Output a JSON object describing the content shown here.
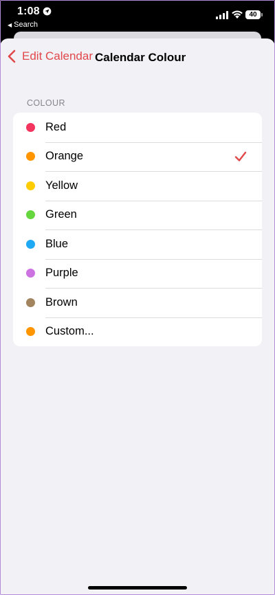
{
  "status_bar": {
    "time": "1:08",
    "back_app": "Search",
    "battery": "40",
    "icons": [
      "location-icon",
      "signal-icon",
      "wifi-icon",
      "battery-icon"
    ]
  },
  "nav": {
    "back_label": "Edit Calendar",
    "title": "Calendar Colour",
    "accent_color": "#e0484a"
  },
  "section": {
    "header": "COLOUR"
  },
  "colours": [
    {
      "label": "Red",
      "color": "#f2345f",
      "selected": false
    },
    {
      "label": "Orange",
      "color": "#ff9500",
      "selected": true
    },
    {
      "label": "Yellow",
      "color": "#ffcc00",
      "selected": false
    },
    {
      "label": "Green",
      "color": "#65d63e",
      "selected": false
    },
    {
      "label": "Blue",
      "color": "#1fa8f3",
      "selected": false
    },
    {
      "label": "Purple",
      "color": "#cc73e1",
      "selected": false
    },
    {
      "label": "Brown",
      "color": "#a2845e",
      "selected": false
    },
    {
      "label": "Custom...",
      "color": "#ff9500",
      "selected": false
    }
  ]
}
